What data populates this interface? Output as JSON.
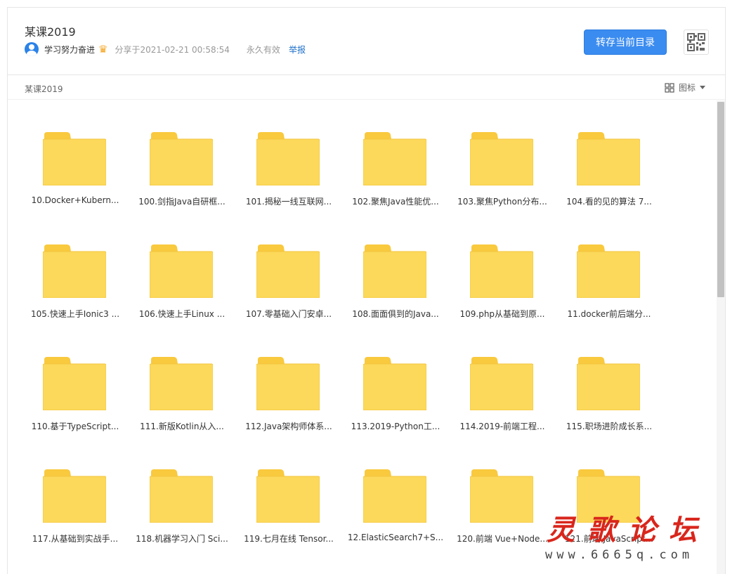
{
  "header": {
    "title": "某课2019",
    "username": "学习努力奋进",
    "crown_icon": "crown-icon",
    "share_time": "分享于2021-02-21 00:58:54",
    "validity": "永久有效",
    "report_label": "举报",
    "save_label": "转存当前目录",
    "accent_color": "#3b8cf0"
  },
  "pathbar": {
    "breadcrumb": "某课2019",
    "view_label": "图标"
  },
  "folder_color": "#fcd95a",
  "items": [
    "10.Docker+Kubern...",
    "100.剑指Java自研框...",
    "101.揭秘一线互联网...",
    "102.聚焦Java性能优...",
    "103.聚焦Python分布...",
    "104.看的见的算法 7...",
    "105.快速上手Ionic3 ...",
    "106.快速上手Linux ...",
    "107.零基础入门安卓...",
    "108.面面俱到的Java...",
    "109.php从基础到原...",
    "11.docker前后端分...",
    "110.基于TypeScript...",
    "111.新版Kotlin从入...",
    "112.Java架构师体系...",
    "113.2019-Python工...",
    "114.2019-前端工程...",
    "115.职场进阶成长系...",
    "117.从基础到实战手...",
    "118.机器学习入门 Sci...",
    "119.七月在线 Tensor...",
    "12.ElasticSearch7+S...",
    "120.前端 Vue+Node...",
    "121.前端 JavaScript..."
  ],
  "watermark": {
    "main": "灵歌论坛",
    "url": "www.6665q.com"
  }
}
